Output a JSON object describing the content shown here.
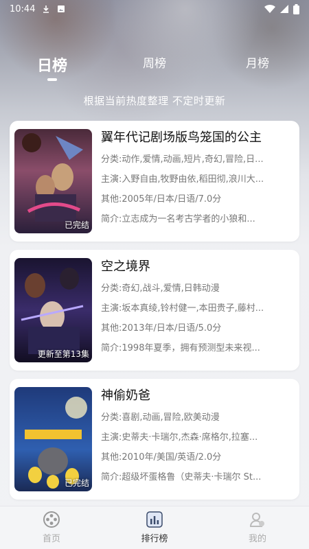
{
  "status_bar": {
    "time": "10:44"
  },
  "tabs": [
    {
      "label": "日榜",
      "active": true
    },
    {
      "label": "周榜",
      "active": false
    },
    {
      "label": "月榜",
      "active": false
    }
  ],
  "subtitle": "根据当前热度整理 不定时更新",
  "items": [
    {
      "title": "翼年代记剧场版鸟笼国的公主",
      "category_label": "分类:",
      "category": "动作,爱情,动画,短片,奇幻,冒险,日...",
      "cast_label": "主演:",
      "cast": "入野自由,牧野由依,稻田彻,浪川大...",
      "other_label": "其他:",
      "other": "2005年/日本/日语/7.0分",
      "intro_label": "简介:",
      "intro": "立志成为一名考古学者的小狼和...",
      "badge": "已完结"
    },
    {
      "title": "空之境界",
      "category_label": "分类:",
      "category": "奇幻,战斗,爱情,日韩动漫",
      "cast_label": "主演:",
      "cast": "坂本真绫,铃村健一,本田贵子,藤村...",
      "other_label": "其他:",
      "other": "2013年/日本/日语/5.0分",
      "intro_label": "简介:",
      "intro": "1998年夏季，拥有预测型未来视...",
      "badge": "更新至第13集"
    },
    {
      "title": "神偷奶爸",
      "category_label": "分类:",
      "category": "喜剧,动画,冒险,欧美动漫",
      "cast_label": "主演:",
      "cast": "史蒂夫·卡瑞尔,杰森·席格尔,拉塞...",
      "other_label": "其他:",
      "other": "2010年/美国/英语/2.0分",
      "intro_label": "简介:",
      "intro": "超级坏蛋格鲁（史蒂夫·卡瑞尔 St...",
      "badge": "已完结"
    }
  ],
  "nav": [
    {
      "label": "首页",
      "icon": "film-reel-icon",
      "active": false
    },
    {
      "label": "排行榜",
      "icon": "bar-chart-icon",
      "active": true
    },
    {
      "label": "我的",
      "icon": "user-icon",
      "active": false
    }
  ],
  "colors": {
    "accent": "#333333",
    "inactive": "#aaaaaa",
    "card_bg": "#ffffff"
  }
}
